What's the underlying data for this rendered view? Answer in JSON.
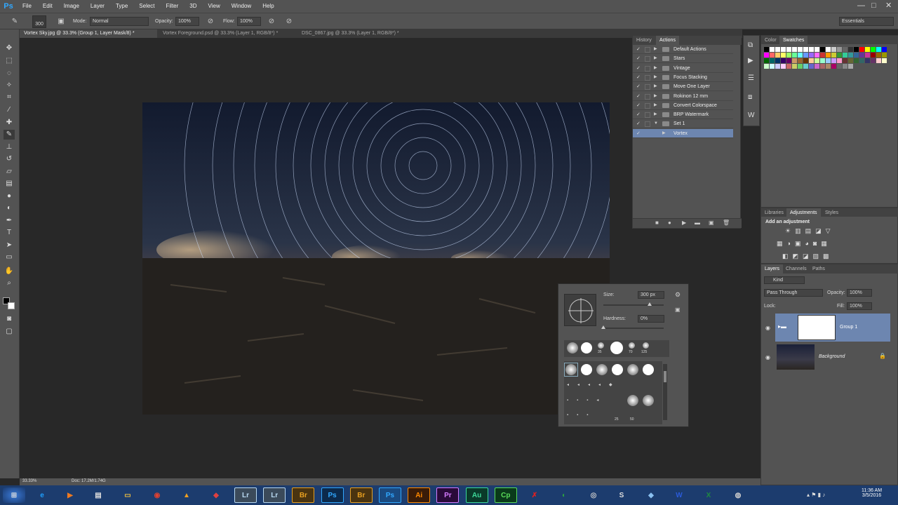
{
  "app": {
    "logo": "Ps"
  },
  "menu": [
    "File",
    "Edit",
    "Image",
    "Layer",
    "Type",
    "Select",
    "Filter",
    "3D",
    "View",
    "Window",
    "Help"
  ],
  "window_controls": {
    "minimize": "—",
    "maximize": "□",
    "close": "✕"
  },
  "options": {
    "brush_size": "300",
    "mode_label": "Mode:",
    "mode_value": "Normal",
    "opacity_label": "Opacity:",
    "opacity_value": "100%",
    "flow_label": "Flow:",
    "flow_value": "100%",
    "workspace": "Essentials"
  },
  "tabs": [
    {
      "label": "Vortex Sky.jpg @ 33.3% (Group 1, Layer Mask/8) *",
      "active": true
    },
    {
      "label": "Vortex Foreground.psd @ 33.3% (Layer 1, RGB/8*) *",
      "active": false
    },
    {
      "label": "DSC_0867.jpg @ 33.3% (Layer 1, RGB/8*) *",
      "active": false
    }
  ],
  "actions_panel": {
    "tabs": [
      "History",
      "Actions"
    ],
    "items": [
      {
        "label": "Default Actions",
        "type": "set"
      },
      {
        "label": "Stars",
        "type": "set"
      },
      {
        "label": "Vintage",
        "type": "set"
      },
      {
        "label": "Focus Stacking",
        "type": "set"
      },
      {
        "label": "Move One Layer",
        "type": "set"
      },
      {
        "label": "Rokinon 12 mm",
        "type": "set"
      },
      {
        "label": "Convert Colorspace",
        "type": "set"
      },
      {
        "label": "BRP Watermark",
        "type": "set"
      },
      {
        "label": "Set 1",
        "type": "open"
      },
      {
        "label": "Vortex",
        "type": "action"
      }
    ]
  },
  "swatches_panel": {
    "tabs": [
      "Color",
      "Swatches"
    ]
  },
  "adjustments_panel": {
    "tabs": [
      "Libraries",
      "Adjustments",
      "Styles"
    ],
    "heading": "Add an adjustment"
  },
  "layers_panel": {
    "tabs": [
      "Layers",
      "Channels",
      "Paths"
    ],
    "filter": "Kind",
    "blend": "Pass Through",
    "opacity_label": "Opacity:",
    "opacity_value": "100%",
    "lock_label": "Lock:",
    "fill_label": "Fill:",
    "fill_value": "100%",
    "layers": [
      {
        "name": "Group 1",
        "selected": true
      },
      {
        "name": "Background",
        "selected": false
      }
    ]
  },
  "brush_picker": {
    "size_label": "Size:",
    "size_value": "300 px",
    "hardness_label": "Hardness:",
    "hardness_value": "0%",
    "size_level": 0.5,
    "hardness_level": 0,
    "preset_numbers_top": [
      "35",
      "70",
      "125"
    ],
    "preset_numbers_bottom": [
      "25",
      "50"
    ]
  },
  "status": {
    "zoom": "33.33%",
    "doc": "Doc: 17.2M/1.74G"
  },
  "clock": {
    "time": "11:36 AM",
    "date": "3/5/2016"
  },
  "taskbar_apps": [
    {
      "label": "Lr",
      "color": "#3b4a5a",
      "fg": "#b8d8f0"
    },
    {
      "label": "Lr",
      "color": "#3b4a5a",
      "fg": "#b8d8f0"
    },
    {
      "label": "Br",
      "color": "#4a3410",
      "fg": "#e8a020"
    },
    {
      "label": "Ps",
      "color": "#0c2a4c",
      "fg": "#31a8ff"
    },
    {
      "label": "Br",
      "color": "#4a3410",
      "fg": "#e8a020"
    },
    {
      "label": "Ps",
      "color": "#1a4a80",
      "fg": "#31a8ff"
    },
    {
      "label": "Ai",
      "color": "#3a1c08",
      "fg": "#ff8a00"
    },
    {
      "label": "Pr",
      "color": "#2a0a3a",
      "fg": "#d47aff"
    },
    {
      "label": "Au",
      "color": "#0a3a2a",
      "fg": "#3dd99a"
    },
    {
      "label": "Cp",
      "color": "#0a3a1a",
      "fg": "#5adc5a"
    }
  ]
}
